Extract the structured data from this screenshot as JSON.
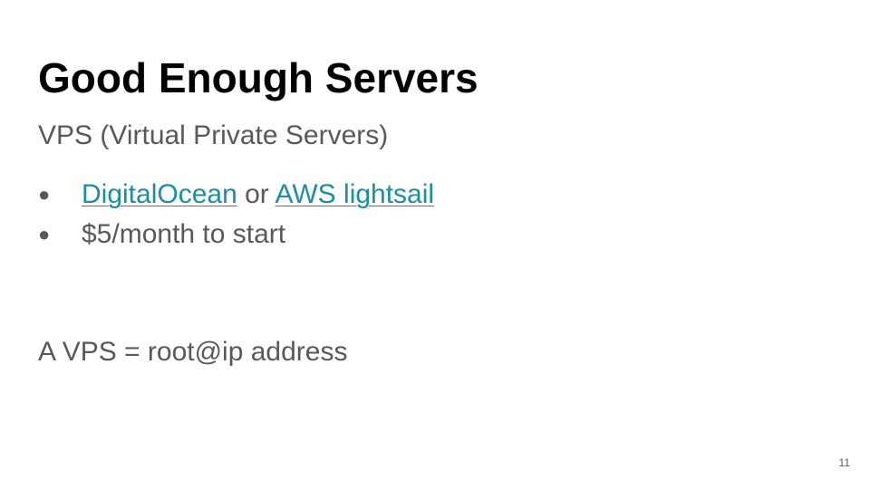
{
  "slide": {
    "title": "Good Enough Servers",
    "subtitle": "VPS (Virtual Private Servers)",
    "bullet_marker": "●",
    "bullets": [
      {
        "link1": "DigitalOcean",
        "connector": " or ",
        "link2": "AWS lightsail"
      },
      {
        "text": "$5/month to start"
      }
    ],
    "body": "A VPS = root@ip address",
    "page_number": "11"
  },
  "colors": {
    "title": "#000000",
    "body_text": "#595959",
    "link": "#1a8fa0",
    "background": "#ffffff"
  }
}
